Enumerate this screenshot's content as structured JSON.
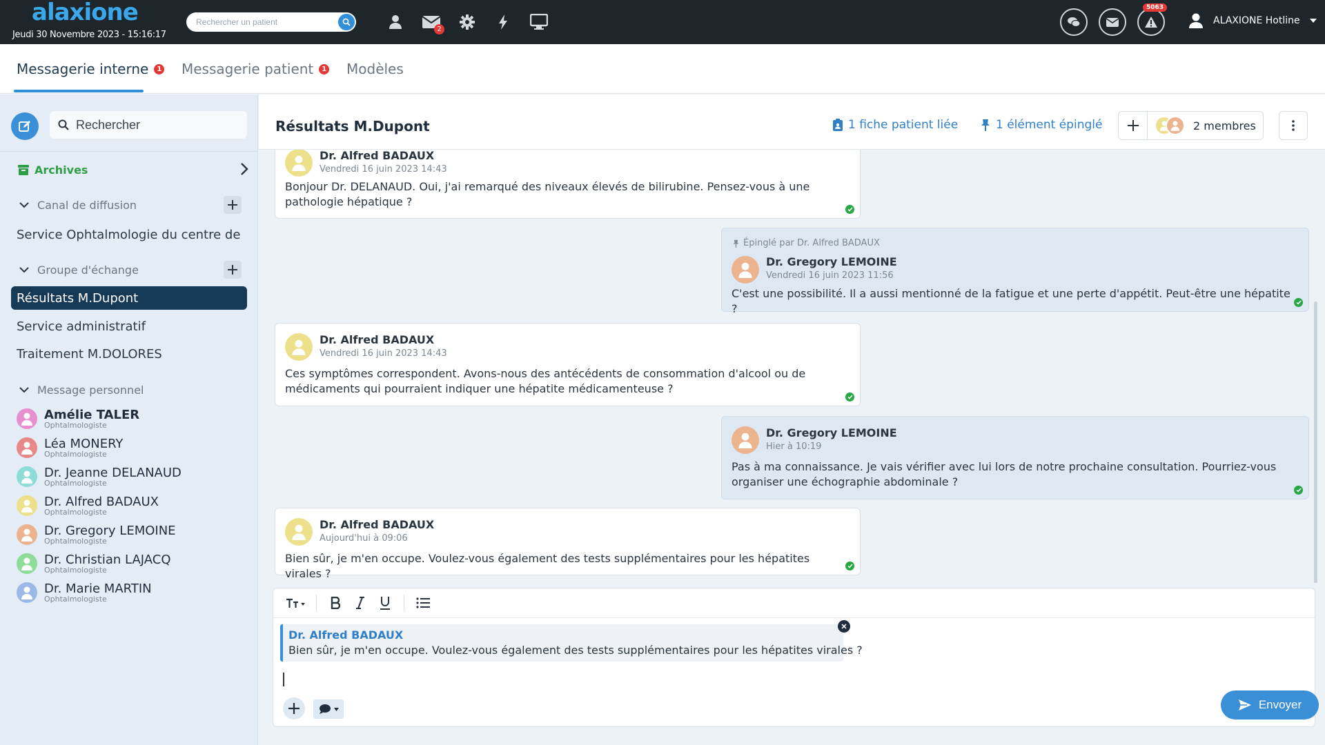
{
  "topbar": {
    "logo": "alaxione",
    "datetime": "Jeudi 30 Novembre 2023 - 15:16:17",
    "search_placeholder": "Rechercher un patient",
    "mail_badge": "2",
    "alert_badge": "5063",
    "user_name": "ALAXIONE Hotline"
  },
  "tabs": [
    {
      "label": "Messagerie interne",
      "badge": "1"
    },
    {
      "label": "Messagerie patient",
      "badge": "1"
    },
    {
      "label": "Modèles"
    }
  ],
  "sidebar": {
    "search_placeholder": "Rechercher",
    "archives_label": "Archives",
    "channel_section": "Canal de diffusion",
    "channels": [
      "Service Ophtalmologie du centre de ..."
    ],
    "group_section": "Groupe d'échange",
    "groups": [
      "Résultats M.Dupont",
      "Service administratif",
      "Traitement M.DOLORES"
    ],
    "personal_section": "Message personnel",
    "contacts": [
      {
        "name": "Amélie TALER",
        "role": "Ophtalmologiste",
        "color": "#e88fd0"
      },
      {
        "name": "Léa MONERY",
        "role": "Ophtalmologiste",
        "color": "#e88888"
      },
      {
        "name": "Dr. Jeanne DELANAUD",
        "role": "Ophtalmologiste",
        "color": "#8edcd8"
      },
      {
        "name": "Dr. Alfred BADAUX",
        "role": "Ophtalmologiste",
        "color": "#ece18a"
      },
      {
        "name": "Dr. Gregory LEMOINE",
        "role": "Ophtalmologiste",
        "color": "#ecb48e"
      },
      {
        "name": "Dr. Christian LAJACQ",
        "role": "Ophtalmologiste",
        "color": "#8edc9a"
      },
      {
        "name": "Dr. Marie MARTIN",
        "role": "Ophtalmologiste",
        "color": "#9ab8e8"
      }
    ]
  },
  "conversation": {
    "title": "Résultats M.Dupont",
    "linked_patient": "1 fiche patient liée",
    "pinned_count": "1 élément épinglé",
    "members": "2 membres",
    "messages": [
      {
        "author": "Dr. Alfred BADAUX",
        "time": "Vendredi 16 juin 2023 14:43",
        "text": "Bonjour Dr. DELANAUD. Oui, j'ai remarqué des niveaux élevés de bilirubine. Pensez-vous à une pathologie hépatique ?"
      },
      {
        "pinned": "Épinglé par Dr. Alfred BADAUX",
        "author": "Dr. Gregory LEMOINE",
        "time": "Vendredi 16 juin 2023 11:56",
        "text": "C'est une possibilité. Il a aussi mentionné de la fatigue et une perte d'appétit. Peut-être une hépatite ?"
      },
      {
        "author": "Dr. Alfred BADAUX",
        "time": "Vendredi 16 juin 2023 14:43",
        "text": "Ces symptômes correspondent. Avons-nous des antécédents de consommation d'alcool ou de médicaments qui pourraient indiquer une hépatite médicamenteuse ?"
      },
      {
        "author": "Dr. Gregory LEMOINE",
        "time": "Hier à 10:19",
        "text": "Pas à ma connaissance. Je vais vérifier avec lui lors de notre prochaine consultation. Pourriez-vous organiser une échographie abdominale ?"
      },
      {
        "author": "Dr. Alfred BADAUX",
        "time": "Aujourd'hui à 09:06",
        "text": "Bien sûr, je m'en occupe. Voulez-vous également des tests supplémentaires pour les hépatites virales ?"
      }
    ]
  },
  "composer": {
    "quote_author": "Dr. Alfred BADAUX",
    "quote_text": "Bien sûr, je m'en occupe. Voulez-vous également des tests supplémentaires pour les hépatites virales ?",
    "send_label": "Envoyer"
  },
  "colors": {
    "topbar": "#1e252b",
    "accent": "#3a8fd6",
    "active_group": "#163a55",
    "archives_green": "#2e9e45",
    "badge_red": "#e53935"
  }
}
